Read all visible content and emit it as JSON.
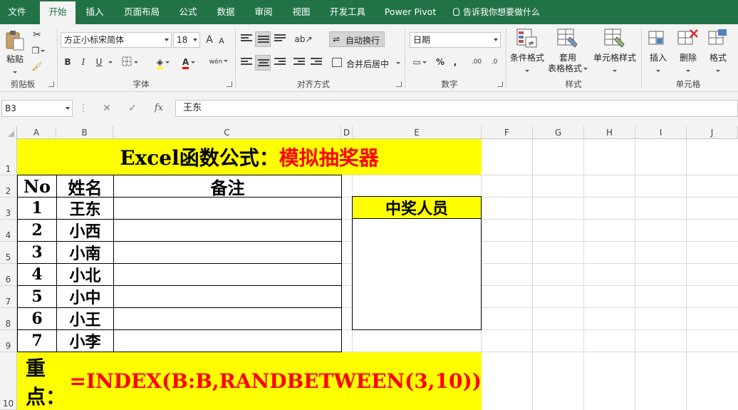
{
  "menu": {
    "tabs": [
      "文件",
      "开始",
      "插入",
      "页面布局",
      "公式",
      "数据",
      "审阅",
      "视图",
      "开发工具",
      "Power Pivot"
    ],
    "tell_me": "告诉我你想要做什么"
  },
  "ribbon": {
    "clipboard": {
      "paste": "粘贴",
      "label": "剪贴板"
    },
    "font": {
      "name": "方正小标宋简体",
      "size": "18",
      "bold": "B",
      "italic": "I",
      "underline": "U",
      "grow": "A",
      "shrink": "A",
      "phonetic": "wén",
      "label": "字体"
    },
    "alignment": {
      "wrap_text": "自动换行",
      "merge_center": "合并后居中",
      "label": "对齐方式"
    },
    "number": {
      "format": "日期",
      "percent": "%",
      "comma": ",",
      "inc_decimal": ".00",
      "dec_decimal": ".0",
      "label": "数字"
    },
    "styles": {
      "conditional": "条件格式",
      "table_format_1": "套用",
      "table_format_2": "表格格式",
      "cell_styles": "单元格样式",
      "label": "样式"
    },
    "cells": {
      "insert": "插入",
      "delete": "删除",
      "format": "格式",
      "label": "单元格"
    }
  },
  "formula_bar": {
    "name_box": "B3",
    "fx": "fx",
    "value": "王东"
  },
  "columns": [
    "A",
    "B",
    "C",
    "D",
    "E",
    "F",
    "G",
    "H",
    "I",
    "J"
  ],
  "rows": [
    "1",
    "2",
    "3",
    "4",
    "5",
    "6",
    "7",
    "8",
    "9",
    "10"
  ],
  "sheet": {
    "title_black": "Excel函数公式：",
    "title_red": "模拟抽奖器",
    "headers": {
      "no": "No",
      "name": "姓名",
      "note": "备注"
    },
    "entries": [
      {
        "no": "1",
        "name": "王东"
      },
      {
        "no": "2",
        "name": "小西"
      },
      {
        "no": "3",
        "name": "小南"
      },
      {
        "no": "4",
        "name": "小北"
      },
      {
        "no": "5",
        "name": "小中"
      },
      {
        "no": "6",
        "name": "小王"
      },
      {
        "no": "7",
        "name": "小李"
      }
    ],
    "winner_header": "中奖人员",
    "key_label": "重点：",
    "key_formula": "=INDEX(B:B,RANDBETWEEN(3,10))"
  },
  "colors": {
    "excel_green": "#217346",
    "highlight_yellow": "#ffff00",
    "formula_red": "#ff0000"
  }
}
